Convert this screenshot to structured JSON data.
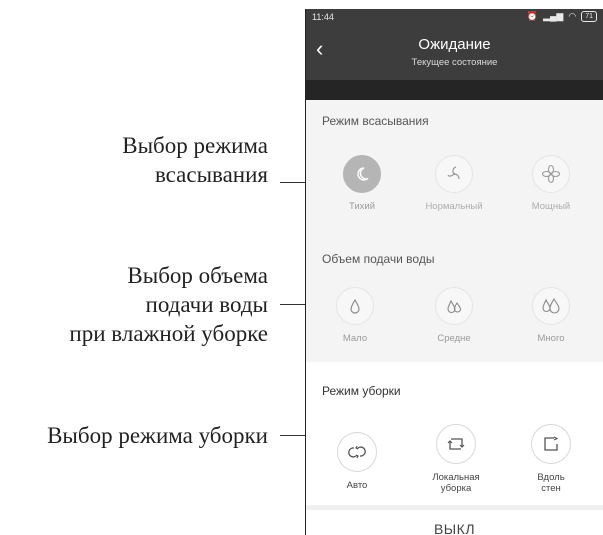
{
  "annotations": {
    "suction": [
      "Выбор режима",
      "всасывания"
    ],
    "water": [
      "Выбор объема",
      "подачи воды",
      "при влажной уборке"
    ],
    "cleaning": [
      "Выбор режима уборки"
    ]
  },
  "status_bar": {
    "time": "11:44",
    "battery": "71"
  },
  "header": {
    "title": "Ожидание",
    "subtitle": "Текущее состояние"
  },
  "suction": {
    "title": "Режим всасывания",
    "options": [
      {
        "label": "Тихий",
        "icon": "moon-icon",
        "selected": true
      },
      {
        "label": "Нормальный",
        "icon": "fan-icon",
        "selected": false
      },
      {
        "label": "Мощный",
        "icon": "flower-fan-icon",
        "selected": false
      }
    ]
  },
  "water": {
    "title": "Объем подачи воды",
    "options": [
      {
        "label": "Мало",
        "icon": "drop-small-icon"
      },
      {
        "label": "Средне",
        "icon": "drop-medium-icon"
      },
      {
        "label": "Много",
        "icon": "drop-large-icon"
      }
    ]
  },
  "cleaning": {
    "title": "Режим уборки",
    "options": [
      {
        "label": "Авто",
        "icon": "auto-route-icon"
      },
      {
        "label": "Локальная уборка",
        "icon": "spot-clean-icon"
      },
      {
        "label": "Вдоль стен",
        "icon": "wall-follow-icon"
      }
    ]
  },
  "footer": {
    "power_label": "ВЫКЛ"
  }
}
